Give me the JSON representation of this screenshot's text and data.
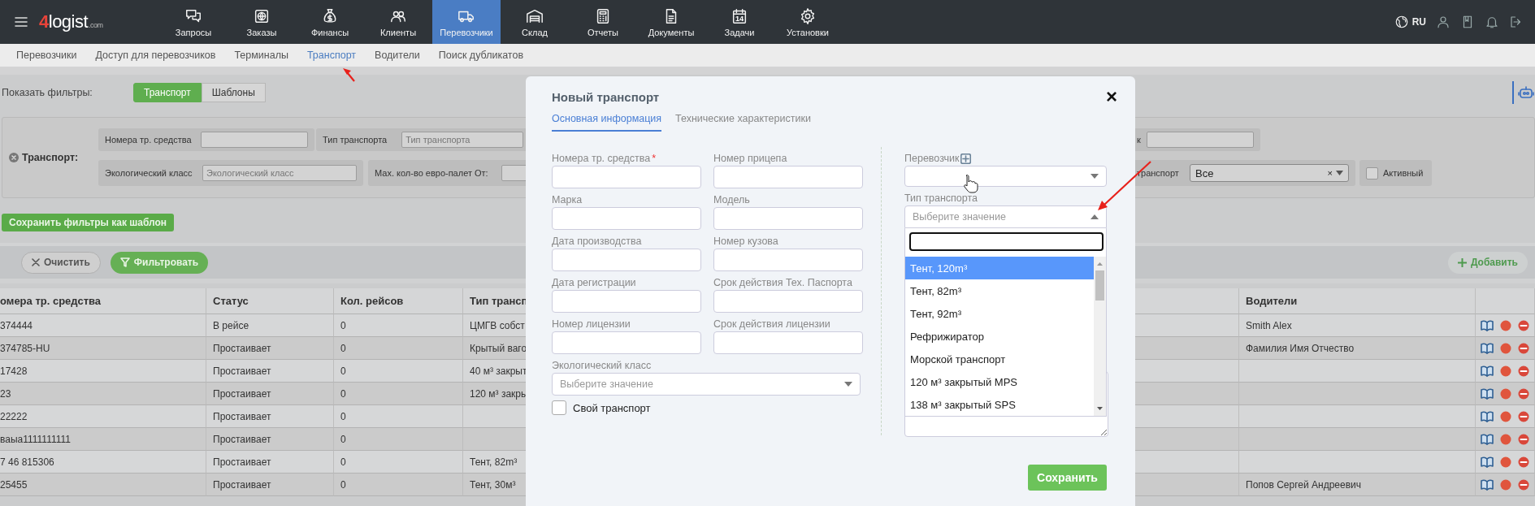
{
  "top_bar": {
    "logo": {
      "mark": "4",
      "name": "logist",
      "suffix": ".com"
    },
    "nav": [
      {
        "label": "Запросы",
        "selected": false
      },
      {
        "label": "Заказы",
        "selected": false
      },
      {
        "label": "Финансы",
        "selected": false
      },
      {
        "label": "Клиенты",
        "selected": false
      },
      {
        "label": "Перевозчики",
        "selected": true
      },
      {
        "label": "Склад",
        "selected": false
      },
      {
        "label": "Отчеты",
        "selected": false
      },
      {
        "label": "Документы",
        "selected": false
      },
      {
        "label": "Задачи",
        "selected": false,
        "icon_text": "14"
      },
      {
        "label": "Установки",
        "selected": false
      }
    ],
    "language": "RU"
  },
  "sub_nav": [
    {
      "label": "Перевозчики",
      "selected": false
    },
    {
      "label": "Доступ для перевозчиков",
      "selected": false
    },
    {
      "label": "Терминалы",
      "selected": false
    },
    {
      "label": "Транспорт",
      "selected": true
    },
    {
      "label": "Водители",
      "selected": false
    },
    {
      "label": "Поиск дубликатов",
      "selected": false
    }
  ],
  "filters": {
    "label": "Показать фильтры:",
    "toggles": [
      {
        "label": "Транспорт",
        "selected": true
      },
      {
        "label": "Шаблоны",
        "selected": false
      }
    ],
    "group_label": "Транспорт:",
    "fields": [
      {
        "kind": "text",
        "label": "Номера тр. средства"
      },
      {
        "kind": "text",
        "label": "Тип транспорта",
        "placeholder": "Тип транспорта"
      },
      {
        "kind": "text",
        "label": "к"
      },
      {
        "kind": "text",
        "label": "Экологический класс",
        "placeholder": "Экологический класс"
      },
      {
        "kind": "text",
        "label": "Мах. кол-во евро-палет От:"
      },
      {
        "kind": "select",
        "label": "транспорт",
        "value": "Все",
        "clear": "×"
      },
      {
        "kind": "checkbox",
        "label": "Активный",
        "checked": false
      }
    ],
    "save_template": "Сохранить фильтры как шаблон"
  },
  "toolbar": {
    "clear": "Очистить",
    "filter": "Фильтровать",
    "add": "Добавить"
  },
  "table": {
    "columns": [
      "омера тр. средства",
      "Статус",
      "Кол. рейсов",
      "Тип трансп",
      "Водители"
    ],
    "rows": [
      {
        "number": "374444",
        "status": "В рейсе",
        "trips": "0",
        "type": "ЦМГВ собст",
        "drivers": "Smith Alex"
      },
      {
        "number": "374785-HU",
        "status": "Простаивает",
        "trips": "0",
        "type": "Крытый ваго",
        "drivers": "Фамилия Имя Отчество"
      },
      {
        "number": "17428",
        "status": "Простаивает",
        "trips": "0",
        "type": "40 м³ закрыт"
      },
      {
        "number": "23",
        "status": "Простаивает",
        "trips": "0",
        "type": "120 м³ закры"
      },
      {
        "number": "22222",
        "status": "Простаивает",
        "trips": "0"
      },
      {
        "number": "ваыа1111111111",
        "status": "Простаивает",
        "trips": "0"
      },
      {
        "number": "7 46 815306",
        "status": "Простаивает",
        "trips": "0",
        "type": "Тент, 82m³"
      },
      {
        "number": "25455",
        "status": "Простаивает",
        "trips": "0",
        "type": "Тент, 30м³",
        "drivers": "Попов Сергей Андреевич"
      }
    ]
  },
  "modal": {
    "title": "Новый транспорт",
    "close": "×",
    "tabs": [
      {
        "label": "Основная информация",
        "selected": true
      },
      {
        "label": "Технические характеристики",
        "selected": false
      }
    ],
    "fields": [
      {
        "kind": "text",
        "label": "Номера тр. средства",
        "mark": "*"
      },
      {
        "kind": "text",
        "label": "Номер прицепа"
      },
      {
        "kind": "text",
        "label": "Марка"
      },
      {
        "kind": "text",
        "label": "Модель"
      },
      {
        "kind": "text",
        "label": "Дата производства"
      },
      {
        "kind": "text",
        "label": "Номер кузова"
      },
      {
        "kind": "text",
        "label": "Дата регистрации"
      },
      {
        "kind": "text",
        "label": "Срок действия Тех. Паспорта"
      },
      {
        "kind": "text",
        "label": "Номер лицензии"
      },
      {
        "kind": "text",
        "label": "Срок действия лицензии"
      },
      {
        "kind": "select",
        "label": "Экологический класс",
        "placeholder": "Выберите значение"
      }
    ],
    "own_transport": {
      "label": "Свой транспорт",
      "checked": false
    },
    "carrier": {
      "label": "Перевозчик"
    },
    "transport_type": {
      "label": "Тип транспорта",
      "placeholder": "Выберите значение",
      "expanded": true,
      "options": [
        {
          "label": "Тент, 120m³",
          "selected": true
        },
        {
          "label": "Тент, 82m³",
          "selected": false
        },
        {
          "label": "Тент, 92m³",
          "selected": false
        },
        {
          "label": "Рефрижиратор",
          "selected": false
        },
        {
          "label": "Морской транспорт",
          "selected": false
        },
        {
          "label": "120 м³ закрытый MPS",
          "selected": false
        },
        {
          "label": "138 м³ закрытый SPS",
          "selected": false
        }
      ]
    },
    "save": "Сохранить"
  }
}
